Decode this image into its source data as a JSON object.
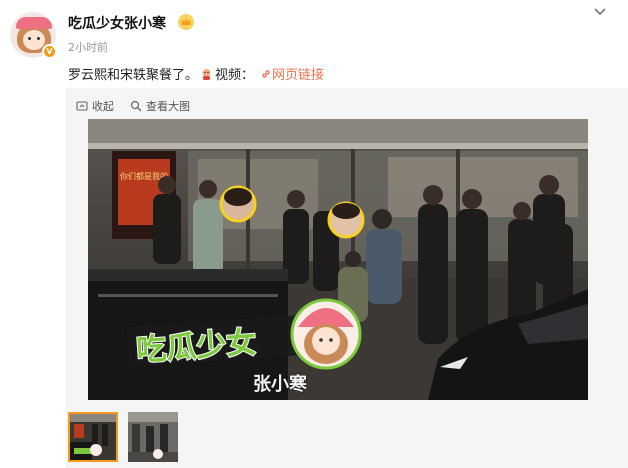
{
  "post": {
    "author": "吃瓜少女张小寒",
    "timestamp": "2小时前",
    "text_before_emoji": "罗云熙和宋轶聚餐了。",
    "text_after_emoji": "视频：",
    "link_text": "网页链接",
    "verified_badge": "V"
  },
  "media_toolbar": {
    "collapse_label": "收起",
    "view_full_label": "查看大图"
  },
  "photo": {
    "watermark_line1": "吃瓜少女",
    "watermark_line2": "张小寒",
    "storefront_sign": "你们都是我的"
  },
  "thumbnails": [
    {
      "label": "photo-1",
      "selected": true
    },
    {
      "label": "photo-2",
      "selected": false
    }
  ],
  "colors": {
    "link": "#eb7350",
    "badge": "#f39c1b",
    "text": "#222222",
    "muted": "#999999"
  },
  "icons": [
    "crown-icon",
    "chevron-down-icon",
    "emoji-icon",
    "link-icon",
    "collapse-icon",
    "magnifier-icon"
  ]
}
